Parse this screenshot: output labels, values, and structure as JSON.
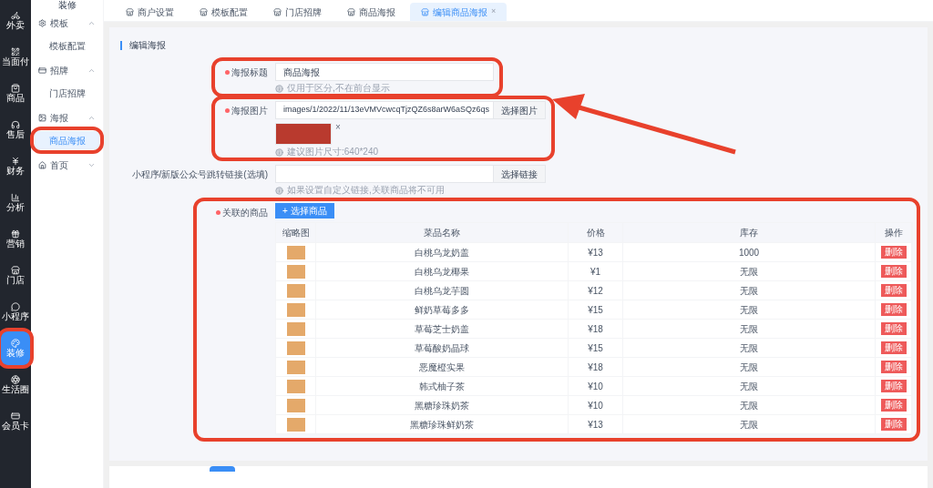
{
  "sidebar": {
    "items": [
      {
        "label": "外卖",
        "selected": false
      },
      {
        "label": "当面付",
        "selected": false
      },
      {
        "label": "商品",
        "selected": false
      },
      {
        "label": "售后",
        "selected": false
      },
      {
        "label": "财务",
        "selected": false
      },
      {
        "label": "分析",
        "selected": false
      },
      {
        "label": "营销",
        "selected": false
      },
      {
        "label": "门店",
        "selected": false
      },
      {
        "label": "小程序",
        "selected": false
      },
      {
        "label": "装修",
        "selected": true
      },
      {
        "label": "生活圈",
        "selected": false
      },
      {
        "label": "会员卡",
        "selected": false
      }
    ]
  },
  "subnav": {
    "title": "装修",
    "groups": [
      {
        "label": "模板",
        "expanded": true,
        "children": [
          {
            "label": "模板配置",
            "selected": false
          }
        ]
      },
      {
        "label": "招牌",
        "expanded": true,
        "children": [
          {
            "label": "门店招牌",
            "selected": false
          }
        ]
      },
      {
        "label": "海报",
        "expanded": true,
        "children": [
          {
            "label": "商品海报",
            "selected": true
          }
        ]
      },
      {
        "label": "首页",
        "expanded": false
      }
    ]
  },
  "tabs": [
    {
      "label": "商户设置",
      "selected": false
    },
    {
      "label": "模板配置",
      "selected": false
    },
    {
      "label": "门店招牌",
      "selected": false
    },
    {
      "label": "商品海报",
      "selected": false
    },
    {
      "label": "编辑商品海报",
      "selected": true,
      "close": "×"
    }
  ],
  "form": {
    "section_title": "编辑海报",
    "fields": [
      {
        "kind": "text",
        "label": "海报标题",
        "required": true,
        "value": "商品海报",
        "hint": "仅用于区分,不在前台显示"
      },
      {
        "kind": "image",
        "label": "海报图片",
        "required": true,
        "value": "images/1/2022/11/13eVMVcwcqTjzQZ6s8arW6aSQz6qs",
        "button": "选择图片",
        "remove": "×",
        "hint": "建议图片尺寸:640*240"
      },
      {
        "kind": "link",
        "label": "小程序/新版公众号跳转链接(选填)",
        "required": false,
        "button": "选择链接",
        "hint": "如果设置自定义链接,关联商品将不可用"
      }
    ],
    "products": {
      "label": "关联的商品",
      "required": true,
      "button": "+ 选择商品",
      "columns": [
        "缩略图",
        "菜品名称",
        "价格",
        "库存",
        "操作"
      ],
      "rows": [
        {
          "name": "白桃乌龙奶盖",
          "price": "¥13",
          "stock": "1000",
          "action": "删除"
        },
        {
          "name": "白桃乌龙椰果",
          "price": "¥1",
          "stock": "无限",
          "action": "删除"
        },
        {
          "name": "白桃乌龙芋圆",
          "price": "¥12",
          "stock": "无限",
          "action": "删除"
        },
        {
          "name": "鲜奶草莓多多",
          "price": "¥15",
          "stock": "无限",
          "action": "删除"
        },
        {
          "name": "草莓芝士奶盖",
          "price": "¥18",
          "stock": "无限",
          "action": "删除"
        },
        {
          "name": "草莓酸奶晶球",
          "price": "¥15",
          "stock": "无限",
          "action": "删除"
        },
        {
          "name": "恶魔橙实果",
          "price": "¥18",
          "stock": "无限",
          "action": "删除"
        },
        {
          "name": "韩式柚子茶",
          "price": "¥10",
          "stock": "无限",
          "action": "删除"
        },
        {
          "name": "黑糖珍珠奶茶",
          "price": "¥10",
          "stock": "无限",
          "action": "删除"
        },
        {
          "name": "黑糖珍珠鲜奶茶",
          "price": "¥13",
          "stock": "无限",
          "action": "删除"
        }
      ]
    }
  }
}
